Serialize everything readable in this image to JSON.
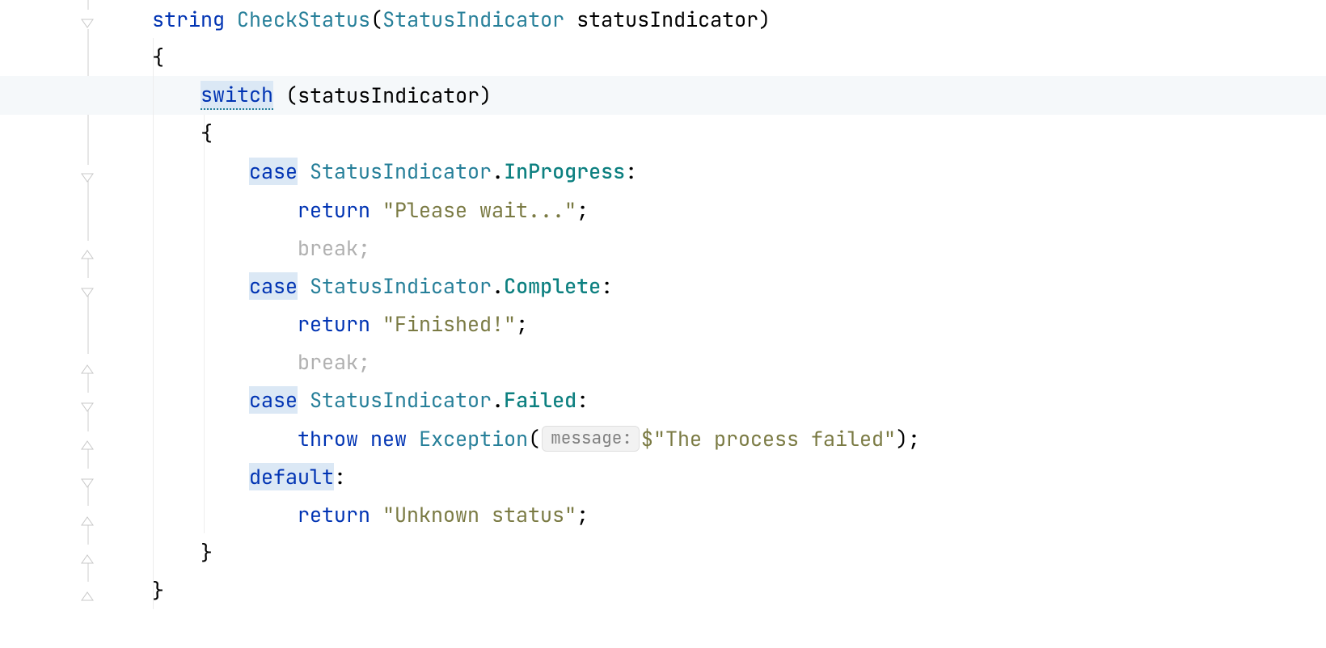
{
  "code": {
    "line1": {
      "kw_string": "string",
      "method": "CheckStatus",
      "paren_open": "(",
      "type": "StatusIndicator",
      "param": "statusIndicator",
      "paren_close": ")"
    },
    "line2": {
      "brace_open": "{"
    },
    "line3": {
      "kw_switch": "switch",
      "paren_open": "(",
      "var": "statusIndicator",
      "paren_close": ")"
    },
    "line4": {
      "brace_open": "{"
    },
    "line5": {
      "kw_case": "case",
      "type": "StatusIndicator",
      "dot": ".",
      "member": "InProgress",
      "colon": ":"
    },
    "line6": {
      "kw_return": "return",
      "string": "\"Please wait...\"",
      "semi": ";"
    },
    "line7": {
      "dead": "break;"
    },
    "line8": {
      "kw_case": "case",
      "type": "StatusIndicator",
      "dot": ".",
      "member": "Complete",
      "colon": ":"
    },
    "line9": {
      "kw_return": "return",
      "string": "\"Finished!\"",
      "semi": ";"
    },
    "line10": {
      "dead": "break;"
    },
    "line11": {
      "kw_case": "case",
      "type": "StatusIndicator",
      "dot": ".",
      "member": "Failed",
      "colon": ":"
    },
    "line12": {
      "kw_throw": "throw",
      "kw_new": "new",
      "type": "Exception",
      "paren_open": "(",
      "hint": "message:",
      "dollar": "$",
      "string": "\"The process failed\"",
      "paren_close": ")",
      "semi": ";"
    },
    "line13": {
      "kw_default": "default",
      "colon": ":"
    },
    "line14": {
      "kw_return": "return",
      "string": "\"Unknown status\"",
      "semi": ";"
    },
    "line15": {
      "brace_close": "}"
    },
    "line16": {
      "brace_close": "}"
    }
  },
  "indent": {
    "l0": "  ",
    "l1": "      ",
    "l2": "          ",
    "l3": "              "
  }
}
